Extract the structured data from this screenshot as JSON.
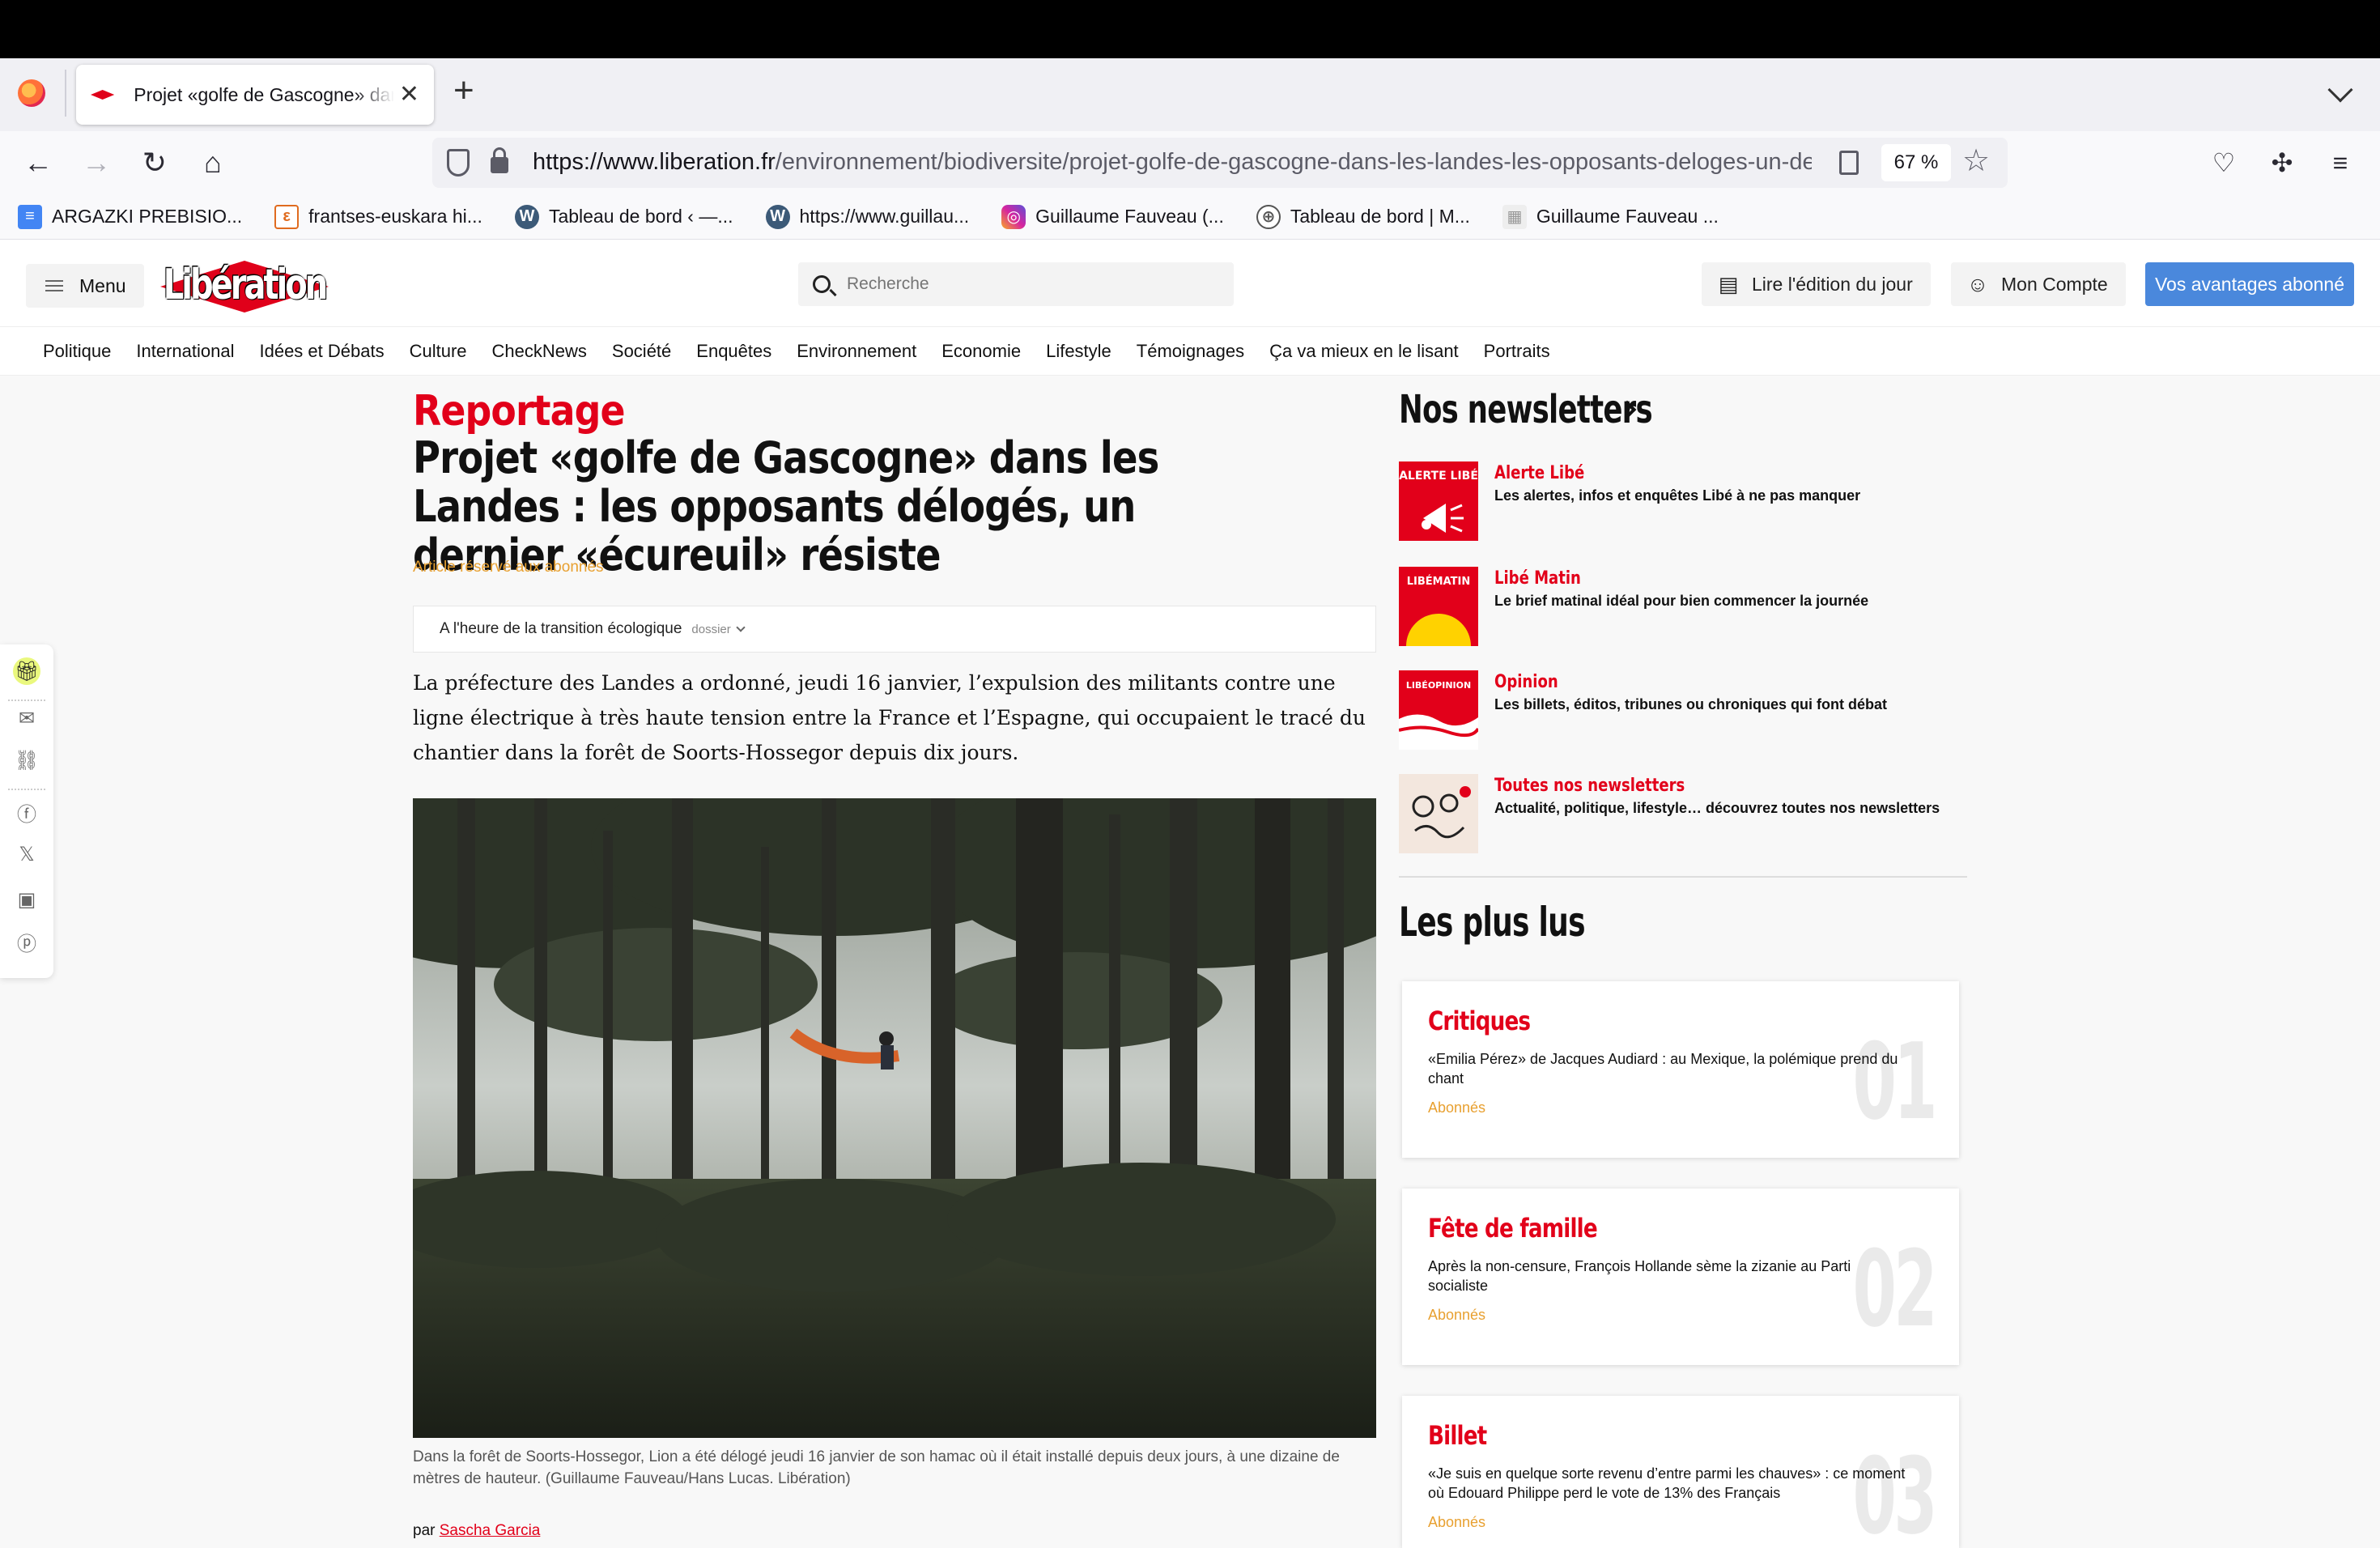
{
  "browser": {
    "tab_title": "Projet «golfe de Gascogne» dans les Landes : les opposants délogés",
    "url_domain": "https://www.liberation.fr",
    "url_path": "/environnement/biodiversite/projet-golfe-de-gascogne-dans-les-landes-les-opposants-deloges-un-dernier-ecureuil-resiste",
    "zoom": "67 %",
    "bookmarks": [
      {
        "label": "ARGAZKI PREBISIO...",
        "icon": "docs-icon",
        "color": "#4285f4"
      },
      {
        "label": "frantses-euskara hi...",
        "icon": "dictionary-icon",
        "color": "#e06b1f"
      },
      {
        "label": "Tableau de bord ‹ —...",
        "icon": "wordpress-icon",
        "color": "#3c5a78"
      },
      {
        "label": "https://www.guillau...",
        "icon": "wordpress-icon",
        "color": "#3c5a78"
      },
      {
        "label": "Guillaume Fauveau (...",
        "icon": "instagram-icon",
        "color": "#d6249f"
      },
      {
        "label": "Tableau de bord | M...",
        "icon": "globe-icon",
        "color": "#555555"
      },
      {
        "label": "Guillaume Fauveau ...",
        "icon": "generic-site-icon",
        "color": "#999999"
      }
    ]
  },
  "site": {
    "menu_label": "Menu",
    "logo_text": "Libération",
    "search_placeholder": "Recherche",
    "edition_label": "Lire l'édition du jour",
    "account_label": "Mon Compte",
    "subscribe_label": "Vos avantages abonné",
    "rubrics": [
      "Politique",
      "International",
      "Idées et Débats",
      "Culture",
      "CheckNews",
      "Société",
      "Enquêtes",
      "Environnement",
      "Economie",
      "Lifestyle",
      "Témoignages",
      "Ça va mieux en le lisant",
      "Portraits"
    ]
  },
  "article": {
    "kicker": "Reportage",
    "title": "Projet «golfe de Gascogne» dans les Landes : les opposants délogés, un dernier «écureuil» résiste",
    "premium": "Article réservé aux abonnés",
    "dossier": "A l'heure de la transition écologique",
    "dossier_tag": "dossier",
    "lead": "La préfecture des Landes a ordonné, jeudi 16 janvier, l’expulsion des militants contre une ligne électrique à très haute tension entre la France et l’Espagne, qui occupaient le tracé du chantier dans la forêt de Soorts-Hossegor depuis dix jours.",
    "caption": "Dans la forêt de Soorts-Hossegor, Lion a été délogé jeudi 16 janvier de son hamac où il était installé depuis deux jours, à une dizaine de mètres de hauteur. (Guillaume Fauveau/Hans Lucas. Libération)",
    "byline_prefix": "par",
    "author": "Sascha Garcia"
  },
  "newsletters": {
    "heading": "Nos newsletters",
    "items": [
      {
        "name": "Alerte Libé",
        "desc": "Les alertes, infos et enquêtes Libé à ne pas manquer",
        "thumb_text": "ALERTE LIBÉ"
      },
      {
        "name": "Libé Matin",
        "desc": "Le brief matinal idéal pour bien commencer la journée",
        "thumb_text": "LIBÉMATIN"
      },
      {
        "name": "Opinion",
        "desc": "Les billets, éditos, tribunes ou chroniques qui font débat",
        "thumb_text": "LIBÉOPINION"
      },
      {
        "name": "Toutes nos newsletters",
        "desc": "Actualité, politique, lifestyle… découvrez toutes nos newsletters",
        "thumb_text": ""
      }
    ]
  },
  "most_read": {
    "heading": "Les plus lus",
    "items": [
      {
        "rubric": "Critiques",
        "title": "«Emilia Pérez» de Jacques Audiard : au Mexique, la polémique prend du chant",
        "tag": "Abonnés",
        "num": "01"
      },
      {
        "rubric": "Fête de famille",
        "title": "Après la non-censure, François Hollande sème la zizanie au Parti socialiste",
        "tag": "Abonnés",
        "num": "02"
      },
      {
        "rubric": "Billet",
        "title": "«Je suis en quelque sorte revenu d’entre parmi les chauves» : ce moment où Edouard Philippe perd le vote de 13% des Français",
        "tag": "Abonnés",
        "num": "03"
      }
    ]
  }
}
